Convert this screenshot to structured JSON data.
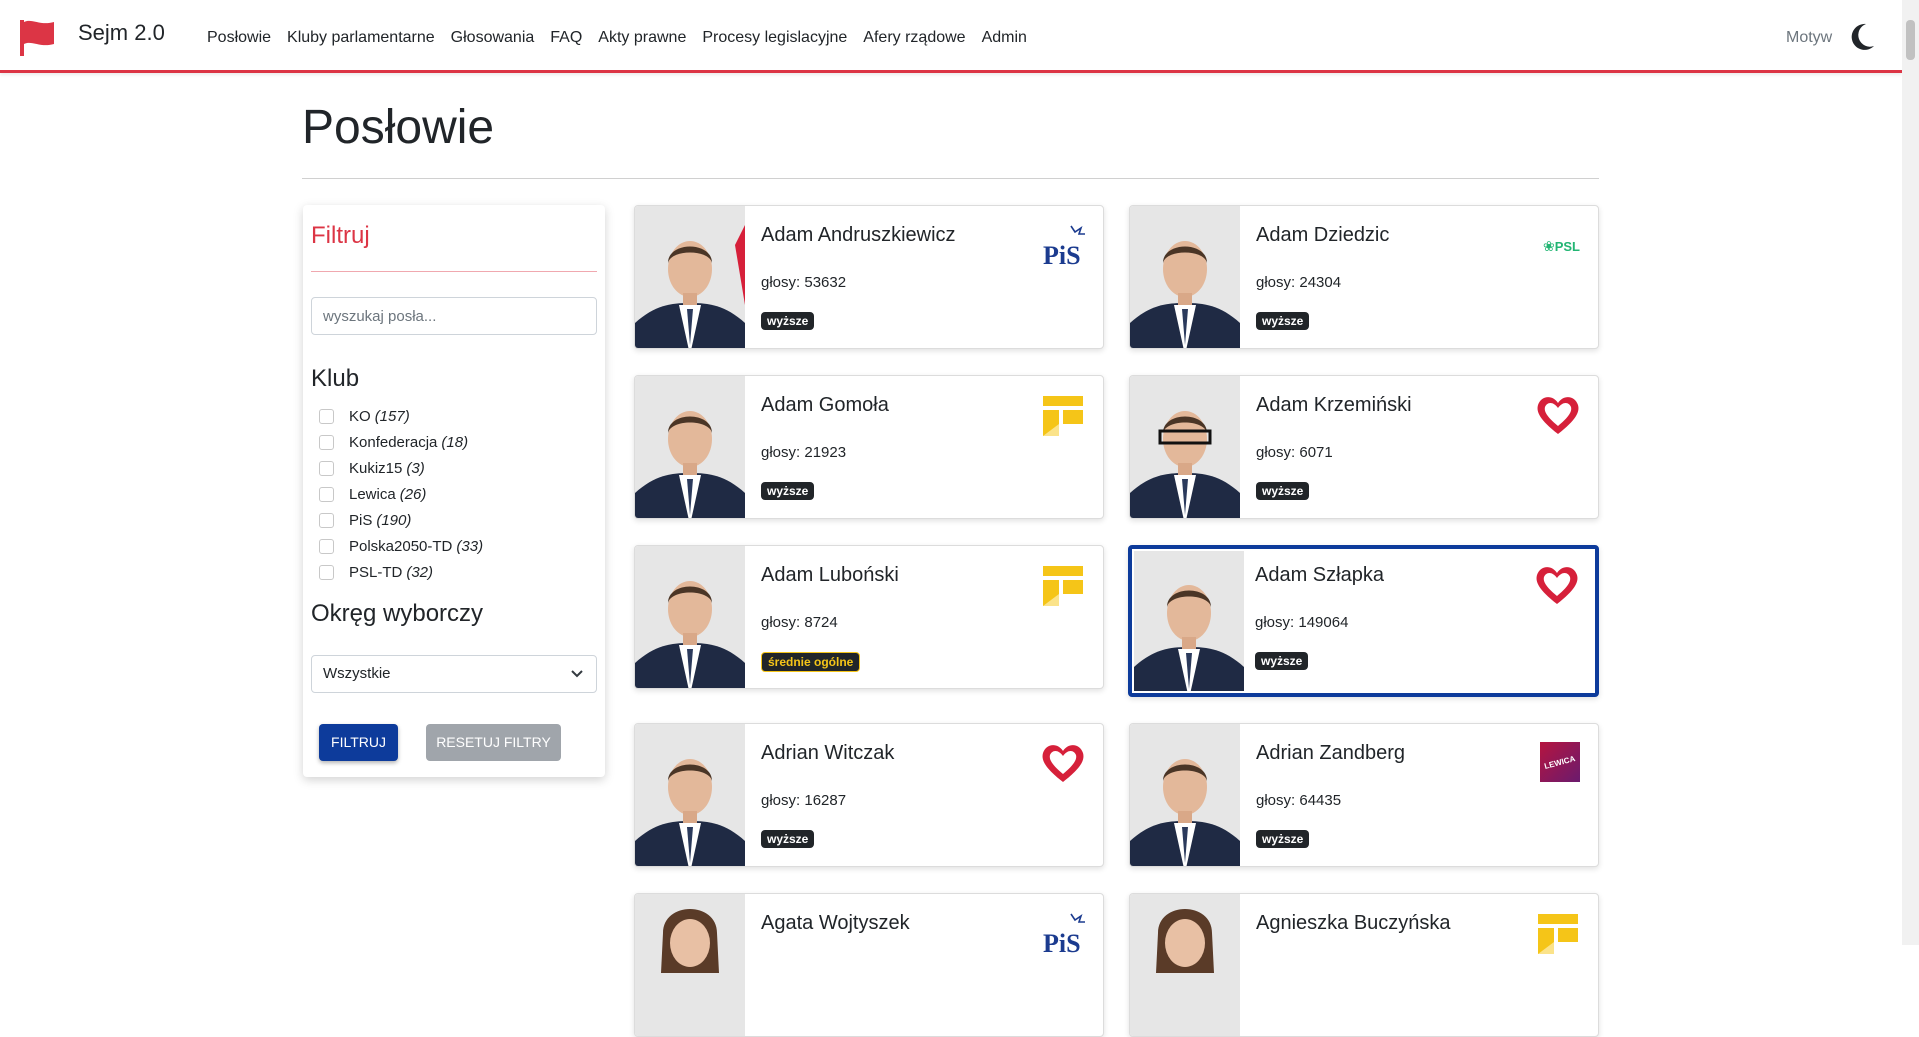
{
  "app": {
    "name": "Sejm 2.0"
  },
  "nav": {
    "items": [
      "Posłowie",
      "Kluby parlamentarne",
      "Głosowania",
      "FAQ",
      "Akty prawne",
      "Procesy legislacyjne",
      "Afery rządowe",
      "Admin"
    ],
    "theme_label": "Motyw"
  },
  "page": {
    "title": "Posłowie"
  },
  "filter": {
    "title": "Filtruj",
    "search_placeholder": "wyszukaj posła...",
    "club_heading": "Klub",
    "clubs": [
      {
        "name": "KO",
        "count": "(157)"
      },
      {
        "name": "Konfederacja",
        "count": "(18)"
      },
      {
        "name": "Kukiz15",
        "count": "(3)"
      },
      {
        "name": "Lewica",
        "count": "(26)"
      },
      {
        "name": "PiS",
        "count": "(190)"
      },
      {
        "name": "Polska2050-TD",
        "count": "(33)"
      },
      {
        "name": "PSL-TD",
        "count": "(32)"
      }
    ],
    "district_heading": "Okręg wyborczy",
    "district_value": "Wszystkie",
    "filter_button": "Filtruj",
    "reset_button": "Resetuj filtry"
  },
  "deputies": [
    {
      "name": "Adam Andruszkiewicz",
      "votes": "głosy: 53632",
      "badge": "wyższe",
      "club_logo": "pis-logo"
    },
    {
      "name": "Adam Dziedzic",
      "votes": "głosy: 24304",
      "badge": "wyższe",
      "club_logo": "psl-logo",
      "logo_text": "PSL"
    },
    {
      "name": "Adam Gomoła",
      "votes": "głosy: 21923",
      "badge": "wyższe",
      "club_logo": "polska2050-logo"
    },
    {
      "name": "Adam Krzemiński",
      "votes": "głosy: 6071",
      "badge": "wyższe",
      "club_logo": "ko-heart-logo"
    },
    {
      "name": "Adam Luboński",
      "votes": "głosy: 8724",
      "badge": "średnie ogólne",
      "club_logo": "polska2050-logo"
    },
    {
      "name": "Adam Szłapka",
      "votes": "głosy: 149064",
      "badge": "wyższe",
      "club_logo": "ko-heart-logo"
    },
    {
      "name": "Adrian Witczak",
      "votes": "głosy: 16287",
      "badge": "wyższe",
      "club_logo": "ko-heart-logo"
    },
    {
      "name": "Adrian Zandberg",
      "votes": "głosy: 64435",
      "badge": "wyższe",
      "club_logo": "lewica-logo",
      "logo_text": "LEWICA"
    },
    {
      "name": "Agata Wojtyszek",
      "votes": "",
      "badge": "",
      "club_logo": "pis-logo"
    },
    {
      "name": "Agnieszka Buczyńska",
      "votes": "",
      "badge": "",
      "club_logo": "polska2050-logo"
    }
  ],
  "colors": {
    "accent_red": "#dc3545",
    "primary_blue": "#0d3b9b",
    "pis_blue": "#1b3b8f",
    "psl_green": "#22b573",
    "ko_red": "#d6203a",
    "lewica": "#b5143f",
    "polska2050_yellow": "#f5c518"
  }
}
